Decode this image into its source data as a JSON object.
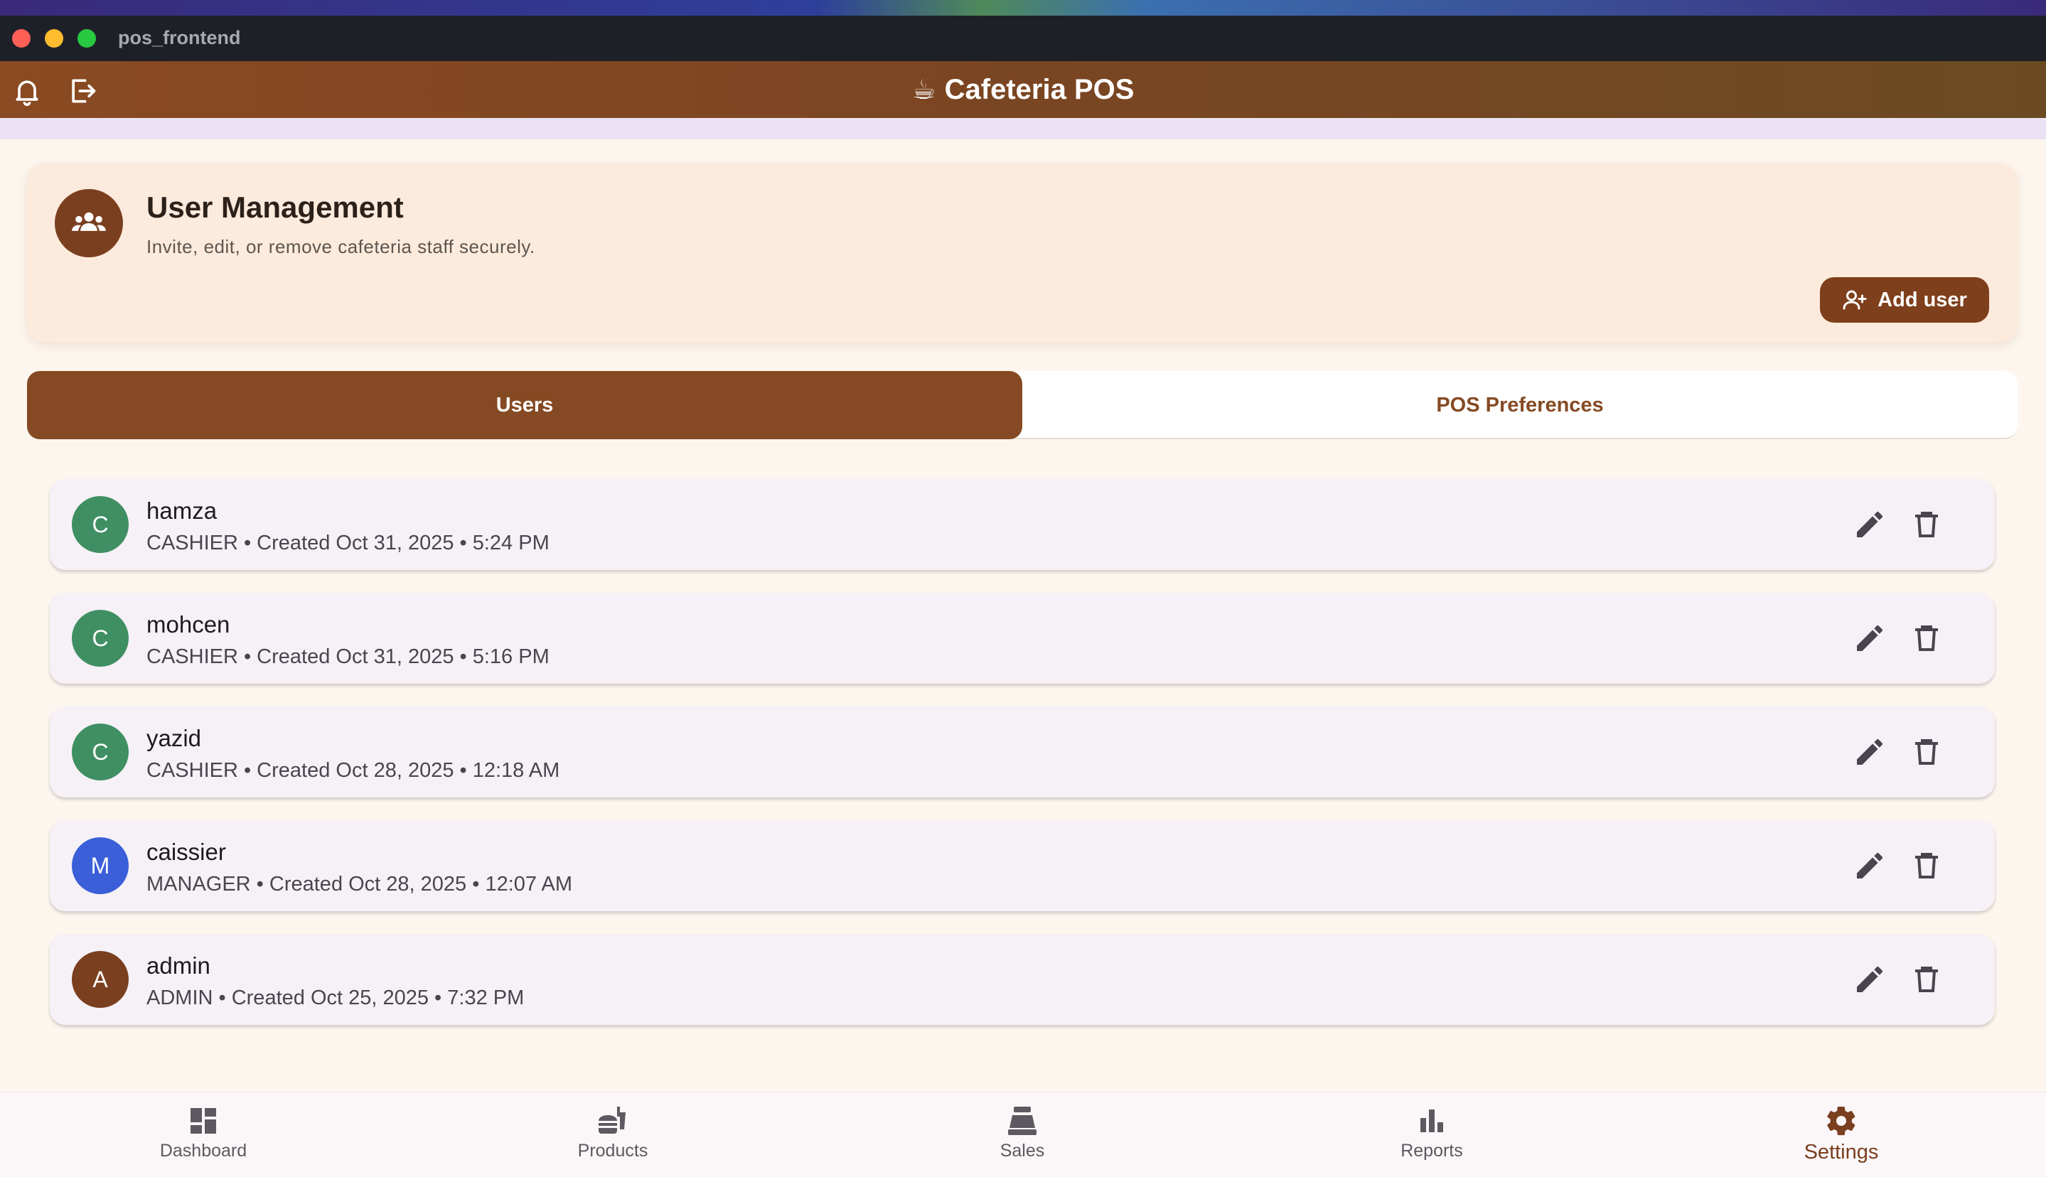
{
  "window": {
    "title": "pos_frontend"
  },
  "appbar": {
    "title": "Cafeteria POS",
    "title_emoji": "☕"
  },
  "header": {
    "title": "User Management",
    "subtitle": "Invite, edit, or remove cafeteria staff securely.",
    "add_button_label": "Add user"
  },
  "tabs": [
    {
      "label": "Users",
      "active": true
    },
    {
      "label": "POS Preferences",
      "active": false
    }
  ],
  "users": [
    {
      "initial": "C",
      "name": "hamza",
      "meta": "CASHIER • Created Oct 31, 2025 • 5:24 PM",
      "color": "#3f8f63"
    },
    {
      "initial": "C",
      "name": "mohcen",
      "meta": "CASHIER • Created Oct 31, 2025 • 5:16 PM",
      "color": "#3f8f63"
    },
    {
      "initial": "C",
      "name": "yazid",
      "meta": "CASHIER • Created Oct 28, 2025 • 12:18 AM",
      "color": "#3f8f63"
    },
    {
      "initial": "M",
      "name": "caissier",
      "meta": "MANAGER • Created Oct 28, 2025 • 12:07 AM",
      "color": "#3a5fd9"
    },
    {
      "initial": "A",
      "name": "admin",
      "meta": "ADMIN • Created Oct 25, 2025 • 7:32 PM",
      "color": "#7a3f1f"
    }
  ],
  "nav": [
    {
      "label": "Dashboard",
      "icon": "dashboard-icon"
    },
    {
      "label": "Products",
      "icon": "fastfood-icon"
    },
    {
      "label": "Sales",
      "icon": "cash-register-icon"
    },
    {
      "label": "Reports",
      "icon": "bar-chart-icon"
    },
    {
      "label": "Settings",
      "icon": "gear-icon",
      "active": true
    }
  ],
  "colors": {
    "brand": "#854a23",
    "brand_dark": "#7a3f1f",
    "background": "#fdf6ef"
  }
}
